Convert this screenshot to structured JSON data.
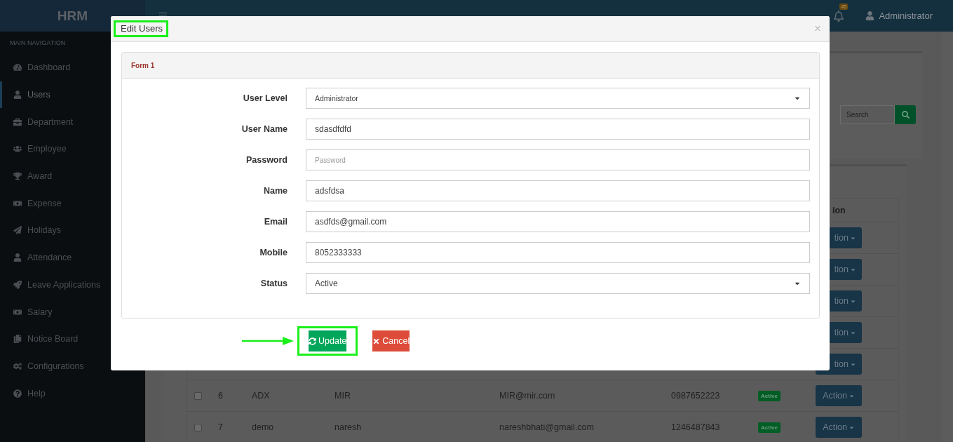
{
  "sidebar": {
    "logo": "HRM",
    "section_title": "MAIN NAVIGATION",
    "items": [
      {
        "label": "Dashboard",
        "selected": false
      },
      {
        "label": "Users",
        "selected": true
      },
      {
        "label": "Department",
        "selected": false
      },
      {
        "label": "Employee",
        "selected": false
      },
      {
        "label": "Award",
        "selected": false
      },
      {
        "label": "Expense",
        "selected": false
      },
      {
        "label": "Holidays",
        "selected": false
      },
      {
        "label": "Attendance",
        "selected": false
      },
      {
        "label": "Leave Applications",
        "selected": false
      },
      {
        "label": "Salary",
        "selected": false
      },
      {
        "label": "Notice Board",
        "selected": false
      },
      {
        "label": "Configurations",
        "selected": false
      },
      {
        "label": "Help",
        "selected": false
      }
    ]
  },
  "header": {
    "notification_count": "45",
    "user": "Administrator"
  },
  "search": {
    "placeholder": "Search"
  },
  "table": {
    "action_header": "ion",
    "rows": [
      {
        "kind": "covered",
        "action": "tion"
      },
      {
        "kind": "covered",
        "action": "tion"
      },
      {
        "kind": "covered",
        "action": "tion"
      },
      {
        "kind": "covered",
        "action": "tion"
      },
      {
        "kind": "covered",
        "action": "tion"
      },
      {
        "kind": "full",
        "checked": false,
        "no": "6",
        "user_name": "ADX",
        "name": "MIR",
        "email": "MIR@mir.com",
        "mobile": "0987652223",
        "status": "Active",
        "action": "Action"
      },
      {
        "kind": "full",
        "checked": false,
        "no": "7",
        "user_name": "demo",
        "name": "naresh",
        "email": "nareshbhati@gmail.com",
        "mobile": "1246487843",
        "status": "Active",
        "action": "Action"
      }
    ]
  },
  "modal": {
    "title": "Edit Users",
    "title_highlighted": true,
    "close": "×",
    "panel_title": "Form 1",
    "fields": [
      {
        "label": "User Level",
        "kind": "select",
        "value": "Administrator"
      },
      {
        "label": "User Name",
        "kind": "text",
        "value": "sdasdfdfd"
      },
      {
        "label": "Password",
        "kind": "text",
        "placeholder": "Password"
      },
      {
        "label": "Name",
        "kind": "text",
        "value": "adsfdsa"
      },
      {
        "label": "Email",
        "kind": "text",
        "value": "asdfds@gmail.com"
      },
      {
        "label": "Mobile",
        "kind": "text",
        "value": "8052333333"
      },
      {
        "label": "Status",
        "kind": "select",
        "value": "Active"
      }
    ],
    "buttons": [
      {
        "label": "Update",
        "kind": "primary",
        "highlighted": true,
        "pointed": true
      },
      {
        "label": "Cancel",
        "kind": "danger",
        "highlighted": false
      }
    ]
  }
}
